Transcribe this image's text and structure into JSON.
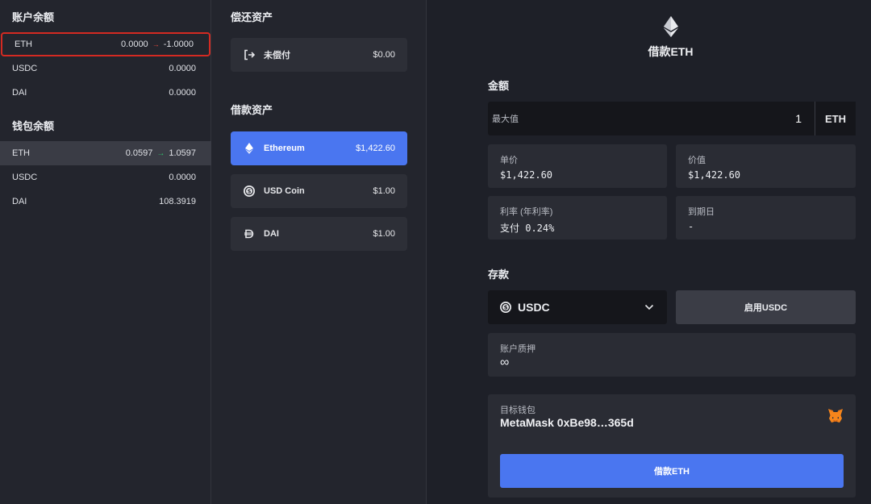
{
  "account_balance": {
    "title": "账户余额",
    "rows": [
      {
        "asset": "ETH",
        "value": "0.0000",
        "arrow": "→",
        "new_value": "-1.0000"
      },
      {
        "asset": "USDC",
        "value": "0.0000"
      },
      {
        "asset": "DAI",
        "value": "0.0000"
      }
    ]
  },
  "wallet_balance": {
    "title": "钱包余额",
    "rows": [
      {
        "asset": "ETH",
        "value": "0.0597",
        "arrow": "→",
        "new_value": "1.0597"
      },
      {
        "asset": "USDC",
        "value": "0.0000"
      },
      {
        "asset": "DAI",
        "value": "108.3919"
      }
    ]
  },
  "repay": {
    "title": "偿还资产",
    "items": [
      {
        "icon": "exit-arrow-icon",
        "label": "未偿付",
        "amount": "$0.00"
      }
    ]
  },
  "borrow": {
    "title": "借款资产",
    "items": [
      {
        "icon": "ethereum-icon",
        "label": "Ethereum",
        "amount": "$1,422.60"
      },
      {
        "icon": "usdc-coin-icon",
        "label": "USD Coin",
        "amount": "$1.00"
      },
      {
        "icon": "dai-icon",
        "label": "DAI",
        "amount": "$1.00"
      }
    ]
  },
  "panel": {
    "title": "借款ETH",
    "amount_label": "金额",
    "max_label": "最大值",
    "amount_value": "1",
    "amount_unit": "ETH",
    "unit_price_label": "单价",
    "unit_price_value": "$1,422.60",
    "value_label": "价值",
    "value_value": "$1,422.60",
    "rate_label": "利率 (年利率)",
    "rate_value": "支付 0.24%",
    "maturity_label": "到期日",
    "maturity_value": "-",
    "deposit_label": "存款",
    "deposit_asset": "USDC",
    "enable_button": "启用USDC",
    "collateral_label": "账户质押",
    "collateral_value": "∞",
    "target_wallet_label": "目标钱包",
    "target_wallet_value": "MetaMask 0xBe98…365d",
    "borrow_button": "借款ETH"
  },
  "colors": {
    "accent": "#4a76f0",
    "background": "#1e2028",
    "highlight_border": "#d42a22",
    "arrow_down": "#e34a3e",
    "arrow_up": "#2fc06b"
  }
}
